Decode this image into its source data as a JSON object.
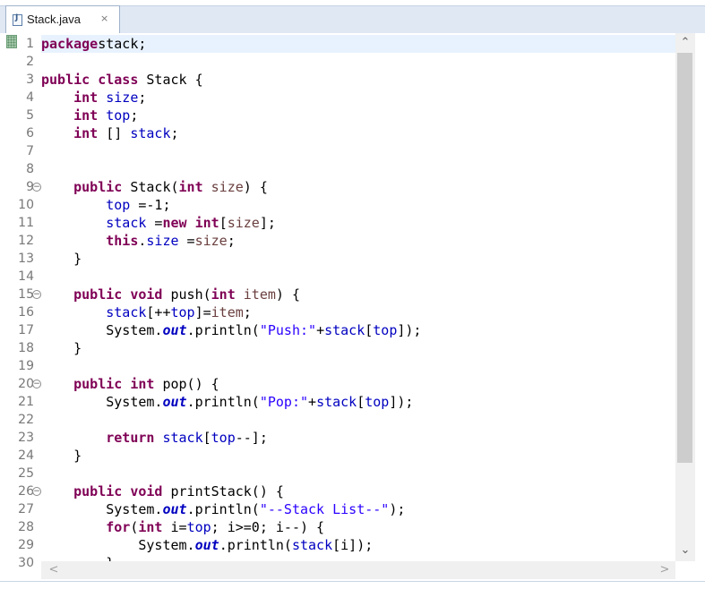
{
  "tab": {
    "title": "Stack.java",
    "close_glyph": "×",
    "icon": "java-file-icon"
  },
  "editor": {
    "fold_glyph": "⊖",
    "lines": [
      {
        "n": "1",
        "fold": false,
        "tokens": [
          [
            "k",
            "package"
          ],
          [
            "",
            "stack;"
          ]
        ]
      },
      {
        "n": "2",
        "fold": false,
        "tokens": []
      },
      {
        "n": "3",
        "fold": false,
        "tokens": [
          [
            "k",
            "public class"
          ],
          [
            "",
            " Stack {"
          ]
        ]
      },
      {
        "n": "4",
        "fold": false,
        "tokens": [
          [
            "",
            "    "
          ],
          [
            "k",
            "int"
          ],
          [
            "",
            " "
          ],
          [
            "f",
            "size"
          ],
          [
            "",
            ";"
          ]
        ]
      },
      {
        "n": "5",
        "fold": false,
        "tokens": [
          [
            "",
            "    "
          ],
          [
            "k",
            "int"
          ],
          [
            "",
            " "
          ],
          [
            "f",
            "top"
          ],
          [
            "",
            ";"
          ]
        ]
      },
      {
        "n": "6",
        "fold": false,
        "tokens": [
          [
            "",
            "    "
          ],
          [
            "k",
            "int"
          ],
          [
            "",
            " [] "
          ],
          [
            "f",
            "stack"
          ],
          [
            "",
            ";"
          ]
        ]
      },
      {
        "n": "7",
        "fold": false,
        "tokens": []
      },
      {
        "n": "8",
        "fold": false,
        "tokens": []
      },
      {
        "n": "9",
        "fold": true,
        "tokens": [
          [
            "",
            "    "
          ],
          [
            "k",
            "public"
          ],
          [
            "",
            " Stack("
          ],
          [
            "k",
            "int"
          ],
          [
            "",
            " "
          ],
          [
            "p",
            "size"
          ],
          [
            "",
            ") {"
          ]
        ]
      },
      {
        "n": "10",
        "fold": false,
        "tokens": [
          [
            "",
            "        "
          ],
          [
            "f",
            "top"
          ],
          [
            "",
            " =-1;"
          ]
        ]
      },
      {
        "n": "11",
        "fold": false,
        "tokens": [
          [
            "",
            "        "
          ],
          [
            "f",
            "stack"
          ],
          [
            "",
            " ="
          ],
          [
            "k",
            "new"
          ],
          [
            "",
            " "
          ],
          [
            "k",
            "int"
          ],
          [
            "",
            "["
          ],
          [
            "p",
            "size"
          ],
          [
            "",
            "];"
          ]
        ]
      },
      {
        "n": "12",
        "fold": false,
        "tokens": [
          [
            "",
            "        "
          ],
          [
            "k",
            "this"
          ],
          [
            "",
            "."
          ],
          [
            "f",
            "size"
          ],
          [
            "",
            " ="
          ],
          [
            "p",
            "size"
          ],
          [
            "",
            ";"
          ]
        ]
      },
      {
        "n": "13",
        "fold": false,
        "tokens": [
          [
            "",
            "    }"
          ]
        ]
      },
      {
        "n": "14",
        "fold": false,
        "tokens": []
      },
      {
        "n": "15",
        "fold": true,
        "tokens": [
          [
            "",
            "    "
          ],
          [
            "k",
            "public void"
          ],
          [
            "",
            " push("
          ],
          [
            "k",
            "int"
          ],
          [
            "",
            " "
          ],
          [
            "p",
            "item"
          ],
          [
            "",
            ") {"
          ]
        ]
      },
      {
        "n": "16",
        "fold": false,
        "tokens": [
          [
            "",
            "        "
          ],
          [
            "f",
            "stack"
          ],
          [
            "",
            "[++"
          ],
          [
            "f",
            "top"
          ],
          [
            "",
            "]="
          ],
          [
            "p",
            "item"
          ],
          [
            "",
            ";"
          ]
        ]
      },
      {
        "n": "17",
        "fold": false,
        "tokens": [
          [
            "",
            "        System."
          ],
          [
            "sf",
            "out"
          ],
          [
            "",
            ".println("
          ],
          [
            "s",
            "\"Push:\""
          ],
          [
            "",
            "+"
          ],
          [
            "f",
            "stack"
          ],
          [
            "",
            "["
          ],
          [
            "f",
            "top"
          ],
          [
            "",
            "]);"
          ]
        ]
      },
      {
        "n": "18",
        "fold": false,
        "tokens": [
          [
            "",
            "    }"
          ]
        ]
      },
      {
        "n": "19",
        "fold": false,
        "tokens": []
      },
      {
        "n": "20",
        "fold": true,
        "tokens": [
          [
            "",
            "    "
          ],
          [
            "k",
            "public int"
          ],
          [
            "",
            " pop() {"
          ]
        ]
      },
      {
        "n": "21",
        "fold": false,
        "tokens": [
          [
            "",
            "        System."
          ],
          [
            "sf",
            "out"
          ],
          [
            "",
            ".println("
          ],
          [
            "s",
            "\"Pop:\""
          ],
          [
            "",
            "+"
          ],
          [
            "f",
            "stack"
          ],
          [
            "",
            "["
          ],
          [
            "f",
            "top"
          ],
          [
            "",
            "]);"
          ]
        ]
      },
      {
        "n": "22",
        "fold": false,
        "tokens": []
      },
      {
        "n": "23",
        "fold": false,
        "tokens": [
          [
            "",
            "        "
          ],
          [
            "k",
            "return"
          ],
          [
            "",
            " "
          ],
          [
            "f",
            "stack"
          ],
          [
            "",
            "["
          ],
          [
            "f",
            "top"
          ],
          [
            "",
            "--];"
          ]
        ]
      },
      {
        "n": "24",
        "fold": false,
        "tokens": [
          [
            "",
            "    }"
          ]
        ]
      },
      {
        "n": "25",
        "fold": false,
        "tokens": []
      },
      {
        "n": "26",
        "fold": true,
        "tokens": [
          [
            "",
            "    "
          ],
          [
            "k",
            "public void"
          ],
          [
            "",
            " printStack() {"
          ]
        ]
      },
      {
        "n": "27",
        "fold": false,
        "tokens": [
          [
            "",
            "        System."
          ],
          [
            "sf",
            "out"
          ],
          [
            "",
            ".println("
          ],
          [
            "s",
            "\"--Stack List--\""
          ],
          [
            "",
            ");"
          ]
        ]
      },
      {
        "n": "28",
        "fold": false,
        "tokens": [
          [
            "",
            "        "
          ],
          [
            "k",
            "for"
          ],
          [
            "",
            "("
          ],
          [
            "k",
            "int"
          ],
          [
            "",
            " i="
          ],
          [
            "f",
            "top"
          ],
          [
            "",
            "; i>=0; i--) {"
          ]
        ]
      },
      {
        "n": "29",
        "fold": false,
        "tokens": [
          [
            "",
            "            System."
          ],
          [
            "sf",
            "out"
          ],
          [
            "",
            ".println("
          ],
          [
            "f",
            "stack"
          ],
          [
            "",
            "[i]);"
          ]
        ]
      },
      {
        "n": "30",
        "fold": false,
        "tokens": [
          [
            "",
            "        }"
          ]
        ]
      }
    ]
  },
  "scrollbar": {
    "up_glyph": "⌃",
    "down_glyph": "⌄",
    "left_glyph": "<",
    "right_glyph": ">",
    "vertical_thumb_fraction": 0.78
  }
}
